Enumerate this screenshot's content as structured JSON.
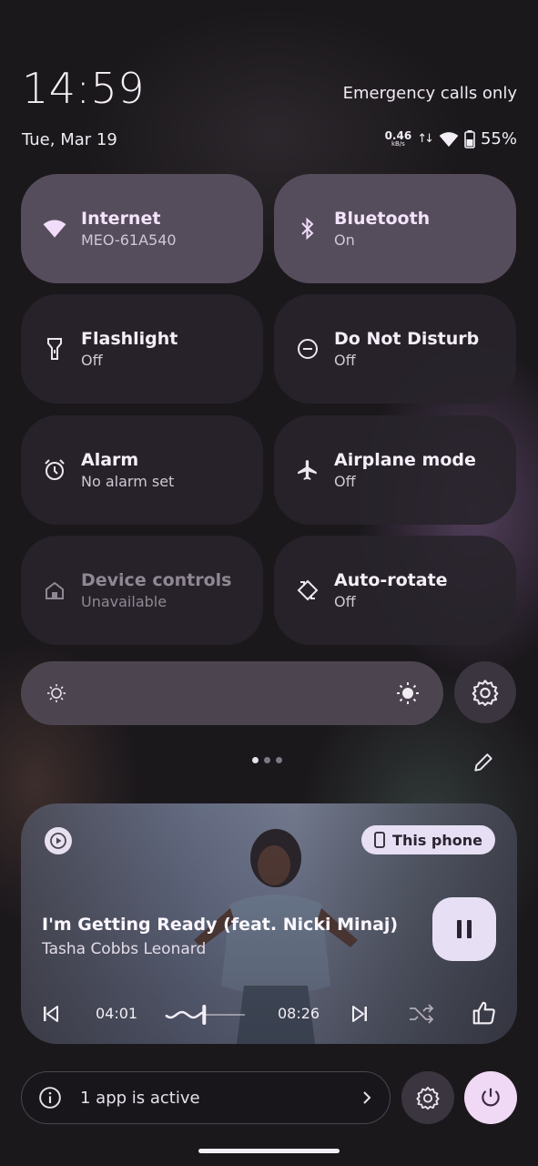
{
  "status": {
    "time": "14:59",
    "date": "Tue, Mar 19",
    "carrier_text": "Emergency calls only",
    "net_speed_value": "0.46",
    "net_speed_unit": "kB/s",
    "battery": "55%"
  },
  "tiles": [
    {
      "title": "Internet",
      "subtitle": "MEO-61A540",
      "icon": "wifi-icon",
      "active": true
    },
    {
      "title": "Bluetooth",
      "subtitle": "On",
      "icon": "bluetooth-icon",
      "active": true
    },
    {
      "title": "Flashlight",
      "subtitle": "Off",
      "icon": "flashlight-icon",
      "active": false
    },
    {
      "title": "Do Not Disturb",
      "subtitle": "Off",
      "icon": "do-not-disturb-icon",
      "active": false
    },
    {
      "title": "Alarm",
      "subtitle": "No alarm set",
      "icon": "alarm-icon",
      "active": false
    },
    {
      "title": "Airplane mode",
      "subtitle": "Off",
      "icon": "airplane-icon",
      "active": false
    },
    {
      "title": "Device controls",
      "subtitle": "Unavailable",
      "icon": "home-icon",
      "active": false
    },
    {
      "title": "Auto-rotate",
      "subtitle": "Off",
      "icon": "auto-rotate-icon",
      "active": false
    }
  ],
  "brightness": {
    "level": 0.0
  },
  "pager": {
    "pages": 3,
    "current": 1
  },
  "media": {
    "song": "I'm Getting Ready (feat. Nicki Minaj)",
    "artist": "Tasha Cobbs Leonard",
    "output_device": "This phone",
    "elapsed": "04:01",
    "duration": "08:26",
    "progress": 0.48
  },
  "footer": {
    "active_apps": "1 app is active"
  },
  "colors": {
    "active_tile": "#564d5c",
    "inactive_tile": "#28242b",
    "accent": "#e7dff3",
    "power": "#f0d9f4"
  }
}
